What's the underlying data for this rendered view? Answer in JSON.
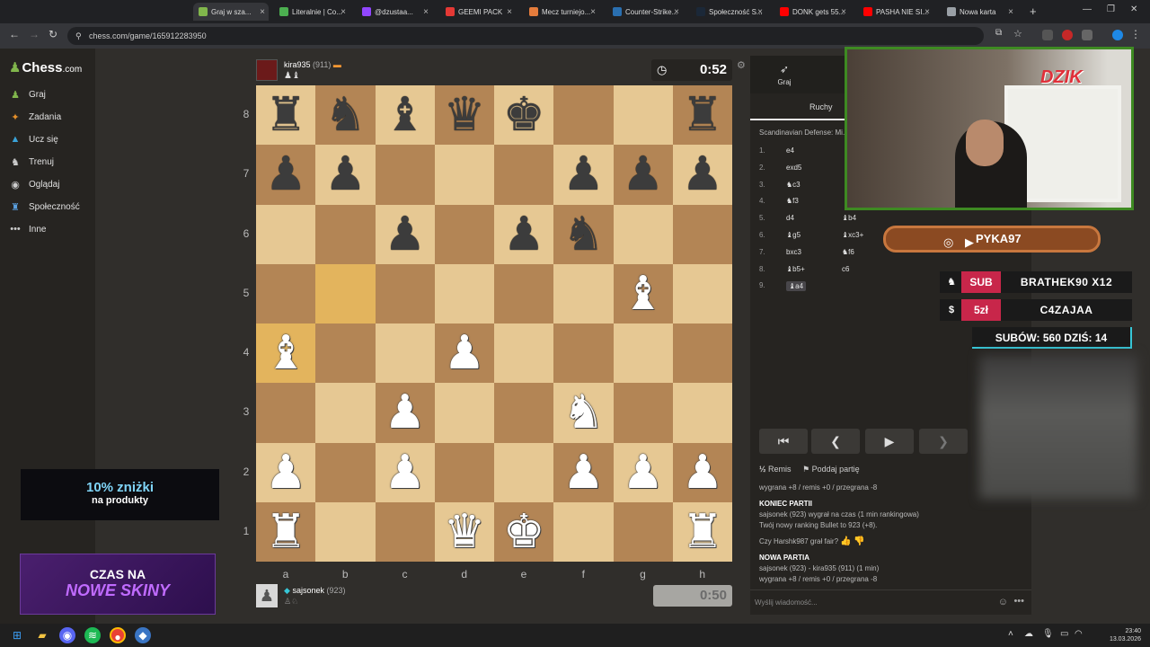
{
  "browser": {
    "tabs": [
      {
        "label": "Graj w sza...",
        "color": "#81b64c"
      },
      {
        "label": "Literalnie | Co...",
        "color": "#4caf50"
      },
      {
        "label": "@dzustaa...",
        "color": "#9146ff"
      },
      {
        "label": "GEEMI PACK",
        "color": "#e53935"
      },
      {
        "label": "Mecz turniejo...",
        "color": "#e57c3c"
      },
      {
        "label": "Counter-Strike...",
        "color": "#2a6fb0"
      },
      {
        "label": "Społeczność S...",
        "color": "#1b2838"
      },
      {
        "label": "DONK gets 55...",
        "color": "#ff0000"
      },
      {
        "label": "PASHA NIE SI...",
        "color": "#ff0000"
      },
      {
        "label": "Nowa karta",
        "color": "#9aa0a6"
      }
    ],
    "url": "chess.com/game/165912283950"
  },
  "sidebar": {
    "logo": "Chess",
    "logo_suffix": ".com",
    "items": [
      {
        "label": "Graj",
        "icon": "pawn-icon"
      },
      {
        "label": "Zadania",
        "icon": "puzzle-icon"
      },
      {
        "label": "Ucz się",
        "icon": "learn-icon"
      },
      {
        "label": "Trenuj",
        "icon": "train-icon"
      },
      {
        "label": "Oglądaj",
        "icon": "watch-icon"
      },
      {
        "label": "Społeczność",
        "icon": "community-icon"
      },
      {
        "label": "Inne",
        "icon": "more-icon"
      }
    ]
  },
  "ads": {
    "discount_big": "10% zniżki",
    "discount_small": "na produkty",
    "skins_l1": "CZAS NA",
    "skins_l2": "NOWE SKINY"
  },
  "opponent": {
    "name": "kira935",
    "rating": "(911)",
    "captured": "♟♝",
    "clock": "0:52"
  },
  "me": {
    "name": "sajsonek",
    "rating": "(923)",
    "clock": "0:50"
  },
  "board": {
    "ranks": [
      "8",
      "7",
      "6",
      "5",
      "4",
      "3",
      "2",
      "1"
    ],
    "files": [
      "a",
      "b",
      "c",
      "d",
      "e",
      "f",
      "g",
      "h"
    ],
    "position": [
      [
        "bR",
        "bN",
        "bB",
        "bQ",
        "bK",
        "",
        "",
        "bR"
      ],
      [
        "bP",
        "bP",
        "",
        "",
        "",
        "bP",
        "bP",
        "bP"
      ],
      [
        "",
        "",
        "bP",
        "",
        "bP",
        "bN",
        "",
        ""
      ],
      [
        "",
        "",
        "",
        "",
        "",
        "",
        "wB",
        ""
      ],
      [
        "wB",
        "",
        "",
        "wP",
        "",
        "",
        "",
        ""
      ],
      [
        "",
        "",
        "wP",
        "",
        "",
        "wN",
        "",
        ""
      ],
      [
        "wP",
        "",
        "wP",
        "",
        "",
        "wP",
        "wP",
        "wP"
      ],
      [
        "wR",
        "",
        "",
        "wQ",
        "wK",
        "",
        "",
        "wR"
      ]
    ],
    "highlights": [
      "b5",
      "a4"
    ]
  },
  "panel": {
    "tab_play": "Graj",
    "subtab_moves": "Ruchy",
    "opening": "Scandinavian Defense: Mi...",
    "moves": [
      {
        "n": "1.",
        "w": "e4",
        "b": ""
      },
      {
        "n": "2.",
        "w": "exd5",
        "b": ""
      },
      {
        "n": "3.",
        "w": "♞c3",
        "b": ""
      },
      {
        "n": "4.",
        "w": "♞f3",
        "b": ""
      },
      {
        "n": "5.",
        "w": "d4",
        "b": "♝b4"
      },
      {
        "n": "6.",
        "w": "♝g5",
        "b": "♝xc3+"
      },
      {
        "n": "7.",
        "w": "bxc3",
        "b": "♞f6"
      },
      {
        "n": "8.",
        "w": "♝b5+",
        "b": "c6"
      },
      {
        "n": "9.",
        "w": "♝a4",
        "b": ""
      }
    ],
    "remis": "Remis",
    "poddaj": "Poddaj partię",
    "chat": {
      "l1": "wygrana +8 / remis +0 / przegrana -8",
      "l2": "KONIEC PARTII",
      "l3": "sajsonek (923) wygrał na czas (1 min rankingowa)",
      "l4": "Twój nowy ranking Bullet to 923 (+8).",
      "l5": "Czy Harshk987 grał fair?",
      "l6": "NOWA PARTIA",
      "l7": "sajsonek (923) - kira935 (911) (1 min)",
      "l8": "wygrana +8 / remis +0 / przegrana -8"
    },
    "message_placeholder": "Wyślij wiadomość..."
  },
  "stream": {
    "cam_logo": "DZIK",
    "social_name": "PYKA97",
    "alert_sub_tag": "SUB",
    "alert_sub_value": "BRATHEK90 X12",
    "alert_don_tag": "5zł",
    "alert_don_value": "C4ZAJAA",
    "counter": "SUBÓW: 560  DZIŚ: 14"
  },
  "taskbar": {
    "time": "23:40",
    "date": "13.03.2026"
  }
}
